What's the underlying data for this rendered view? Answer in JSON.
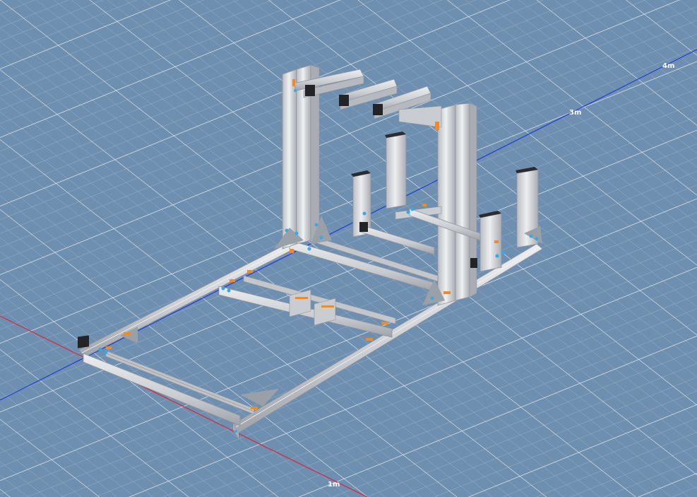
{
  "viewport": {
    "background": "#6f8fb0",
    "grid_minor_color": "#93adc8",
    "grid_major_color": "#e4ecf4"
  },
  "axes": {
    "x_color": "#d9263a",
    "z_color": "#1f3cd6",
    "labels": {
      "one_m": "1m",
      "three_m": "3m",
      "four_m": "4m"
    }
  },
  "model": {
    "profile_color": "#d9dbdf",
    "profile_shadow": "#a9adb3",
    "bracket_color": "#ee8a2a",
    "endcap_color": "#222428",
    "gusset_color": "#9aa0a8",
    "fastener_color": "#38a8e6"
  }
}
